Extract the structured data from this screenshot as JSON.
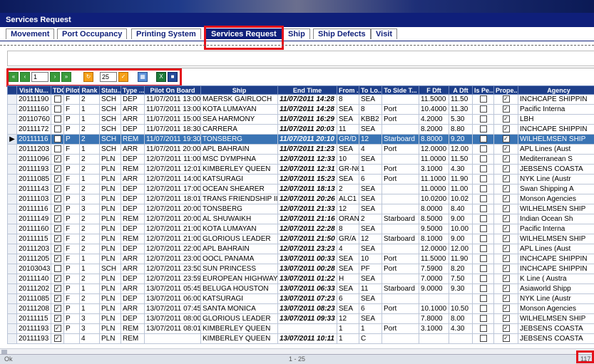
{
  "app": {
    "title": "Services Request"
  },
  "tabs": [
    {
      "label": "Movement",
      "active": false
    },
    {
      "label": "Port Occupancy",
      "active": false
    },
    {
      "label": "Printing System",
      "active": false
    },
    {
      "label": "Services Request",
      "active": true
    },
    {
      "label": "Ship",
      "active": false
    },
    {
      "label": "Ship Defects",
      "active": false
    },
    {
      "label": "Visit",
      "active": false
    }
  ],
  "toolbar": {
    "page": "1",
    "page_size": "25"
  },
  "columns": [
    "Visit Nu...",
    "TDC",
    "Pilot...",
    "Rank",
    "Statu...",
    "Type ...",
    "Pilot On Board",
    "Ship",
    "End Time",
    "From ...",
    "To Lo...",
    "To Side T...",
    "F Dft",
    "A Dft",
    "Is Pe...",
    "Prope...",
    "Agency"
  ],
  "rows": [
    [
      "20111190",
      false,
      "F",
      "2",
      "SCH",
      "DEP",
      "11/07/2011 13:00",
      "MAERSK GAIRLOCH",
      "11/07/2011 14:28",
      "8",
      "SEA",
      "",
      "11.5000",
      "11.50",
      false,
      true,
      "INCHCAPE SHIPPIN"
    ],
    [
      "20111160",
      false,
      "F",
      "1",
      "SCH",
      "ARR",
      "11/07/2011 13:00",
      "KOTA LUMAYAN",
      "11/07/2011 14:28",
      "SEA",
      "8",
      "Port",
      "10.4000",
      "11.30",
      false,
      true,
      "Pacific Interna"
    ],
    [
      "20110760",
      false,
      "P",
      "1",
      "SCH",
      "ARR",
      "11/07/2011 15:00",
      "SEA HARMONY",
      "11/07/2011 16:29",
      "SEA",
      "KBB2",
      "Port",
      "4.2000",
      "5.30",
      false,
      true,
      "LBH"
    ],
    [
      "20111172",
      false,
      "P",
      "2",
      "SCH",
      "DEP",
      "11/07/2011 18:30",
      "CARRERA",
      "11/07/2011 20:03",
      "11",
      "SEA",
      "",
      "8.2000",
      "8.80",
      false,
      true,
      "INCHCAPE SHIPPIN"
    ],
    [
      "20111116",
      false,
      "P",
      "2",
      "SCH",
      "REM",
      "11/07/2011 19:30",
      "TONSBERG",
      "11/07/2011 20:10",
      "GR/D",
      "12",
      "Starboard",
      "8.8000",
      "9.20",
      false,
      true,
      "WILHELMSEN SHIP"
    ],
    [
      "20111203",
      false,
      "F",
      "1",
      "SCH",
      "ARR",
      "11/07/2011 20:00",
      "APL BAHRAIN",
      "11/07/2011 21:23",
      "SEA",
      "4",
      "Port",
      "12.0000",
      "12.00",
      false,
      true,
      "APL Lines (Aust"
    ],
    [
      "20111096",
      true,
      "F",
      "2",
      "PLN",
      "DEP",
      "12/07/2011 11:00",
      "MSC DYMPHNA",
      "12/07/2011 12:33",
      "10",
      "SEA",
      "",
      "11.0000",
      "11.50",
      false,
      true,
      "Mediterranean S"
    ],
    [
      "20111193",
      true,
      "P",
      "2",
      "PLN",
      "REM",
      "12/07/2011 12:01",
      "KIMBERLEY QUEEN",
      "12/07/2011 12:31",
      "GR-N6",
      "1",
      "Port",
      "3.1000",
      "4.30",
      false,
      true,
      "JEBSENS COASTA"
    ],
    [
      "20111085",
      true,
      "F",
      "1",
      "PLN",
      "ARR",
      "12/07/2011 14:00",
      "KATSURAGI",
      "12/07/2011 15:23",
      "SEA",
      "6",
      "Port",
      "11.1000",
      "11.90",
      false,
      true,
      "NYK Line (Austr"
    ],
    [
      "20111143",
      true,
      "F",
      "2",
      "PLN",
      "DEP",
      "12/07/2011 17:00",
      "OCEAN SHEARER",
      "12/07/2011 18:13",
      "2",
      "SEA",
      "",
      "11.0000",
      "11.00",
      false,
      true,
      "Swan Shipping A"
    ],
    [
      "20111103",
      true,
      "P",
      "3",
      "PLN",
      "DEP",
      "12/07/2011 18:01",
      "TRANS FRIENDSHIP II",
      "12/07/2011 20:26",
      "ALC1",
      "SEA",
      "",
      "10.0200",
      "10.02",
      false,
      true,
      "Monson Agencies"
    ],
    [
      "20111116",
      true,
      "P",
      "3",
      "PLN",
      "DEP",
      "12/07/2011 20:00",
      "TONSBERG",
      "12/07/2011 21:33",
      "12",
      "SEA",
      "",
      "8.0000",
      "8.40",
      false,
      true,
      "WILHELMSEN SHIP"
    ],
    [
      "20111149",
      true,
      "P",
      "2",
      "PLN",
      "REM",
      "12/07/2011 20:00",
      "AL SHUWAIKH",
      "12/07/2011 21:16",
      "ORAN",
      "2",
      "Starboard",
      "8.5000",
      "9.00",
      false,
      true,
      "Indian Ocean Sh"
    ],
    [
      "20111160",
      true,
      "F",
      "2",
      "PLN",
      "DEP",
      "12/07/2011 21:00",
      "KOTA LUMAYAN",
      "12/07/2011 22:28",
      "8",
      "SEA",
      "",
      "9.5000",
      "10.00",
      false,
      true,
      "Pacific Interna"
    ],
    [
      "20111115",
      true,
      "F",
      "2",
      "PLN",
      "REM",
      "12/07/2011 21:00",
      "GLORIOUS LEADER",
      "12/07/2011 21:50",
      "GR/A",
      "12",
      "Starboard",
      "8.1000",
      "9.00",
      false,
      true,
      "WILHELMSEN SHIP"
    ],
    [
      "20111203",
      true,
      "F",
      "2",
      "PLN",
      "DEP",
      "12/07/2011 22:00",
      "APL BAHRAIN",
      "12/07/2011 23:23",
      "4",
      "SEA",
      "",
      "12.0000",
      "12.00",
      false,
      true,
      "APL Lines (Aust"
    ],
    [
      "20111205",
      true,
      "F",
      "1",
      "PLN",
      "ARR",
      "12/07/2011 23:00",
      "OOCL PANAMA",
      "13/07/2011 00:33",
      "SEA",
      "10",
      "Port",
      "11.5000",
      "11.90",
      false,
      true,
      "INCHCAPE SHIPPIN"
    ],
    [
      "20103043",
      false,
      "P",
      "1",
      "SCH",
      "ARR",
      "12/07/2011 23:50",
      "SUN PRINCESS",
      "13/07/2011 00:28",
      "SEA",
      "PF",
      "Port",
      "7.5900",
      "8.20",
      false,
      true,
      "INCHCAPE SHIPPIN"
    ],
    [
      "20111140",
      true,
      "P",
      "2",
      "PLN",
      "DEP",
      "12/07/2011 23:59",
      "EUROPEAN HIGHWAY",
      "13/07/2011 01:22",
      "H",
      "SEA",
      "",
      "7.0000",
      "7.50",
      false,
      true,
      "K Line ( Austra"
    ],
    [
      "20111202",
      true,
      "P",
      "1",
      "PLN",
      "ARR",
      "13/07/2011 05:45",
      "BELUGA HOUSTON",
      "13/07/2011 06:33",
      "SEA",
      "11",
      "Starboard",
      "9.0000",
      "9.30",
      false,
      true,
      "Asiaworld Shipp"
    ],
    [
      "20111085",
      true,
      "F",
      "2",
      "PLN",
      "DEP",
      "13/07/2011 06:00",
      "KATSURAGI",
      "13/07/2011 07:23",
      "6",
      "SEA",
      "",
      "",
      "",
      false,
      true,
      "NYK Line (Austr"
    ],
    [
      "20111208",
      true,
      "P",
      "1",
      "PLN",
      "ARR",
      "13/07/2011 07:45",
      "SANTA MONICA",
      "13/07/2011 08:23",
      "SEA",
      "6",
      "Port",
      "10.1000",
      "10.50",
      false,
      true,
      "Monson Agencies"
    ],
    [
      "20111115",
      true,
      "P",
      "3",
      "PLN",
      "DEP",
      "13/07/2011 08:00",
      "GLORIOUS LEADER",
      "13/07/2011 09:33",
      "12",
      "SEA",
      "",
      "7.8000",
      "8.00",
      false,
      true,
      "WILHELMSEN SHIP"
    ],
    [
      "20111193",
      true,
      "P",
      "3",
      "PLN",
      "REM",
      "13/07/2011 08:01",
      "KIMBERLEY QUEEN",
      "",
      "1",
      "1",
      "Port",
      "3.1000",
      "4.30",
      false,
      true,
      "JEBSENS COASTA"
    ],
    [
      "20111193",
      true,
      "",
      "4",
      "PLN",
      "REM",
      "",
      "KIMBERLEY QUEEN",
      "13/07/2011 10:11",
      "1",
      "C",
      "",
      "",
      "",
      false,
      true,
      "JEBSENS COASTA"
    ]
  ],
  "selected_row": 4,
  "status": {
    "left": "Ok",
    "range": "1 - 25",
    "total": "117"
  },
  "colors": {
    "header": "#1e3f8a",
    "title": "#0f1f7a",
    "selected": "#3a74b4",
    "highlight": "#e3101b"
  }
}
